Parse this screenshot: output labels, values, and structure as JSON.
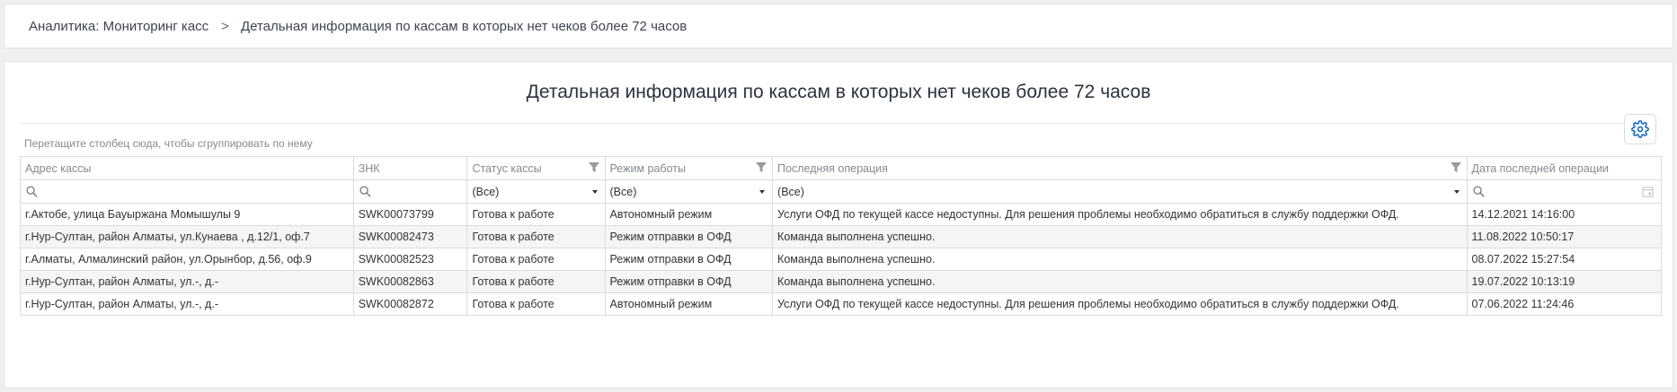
{
  "breadcrumb": {
    "parent": "Аналитика: Мониторинг касс",
    "separator": ">",
    "current": "Детальная информация по кассам в которых нет чеков более 72 часов"
  },
  "panel": {
    "title": "Детальная информация по кассам в которых нет чеков более 72 часов",
    "group_hint": "Перетащите столбец сюда, чтобы сгруппировать по нему",
    "settings_icon": "gear-icon"
  },
  "colors": {
    "accent": "#1a6fc1",
    "row_alt": "#f5f5f5",
    "border": "#dcdcdc"
  },
  "table": {
    "columns": [
      {
        "label": "Адрес кассы"
      },
      {
        "label": "ЗНК"
      },
      {
        "label": "Статус кассы",
        "filter_icon": "funnel-icon"
      },
      {
        "label": "Режим работы",
        "filter_icon": "funnel-icon"
      },
      {
        "label": "Последняя операция",
        "filter_icon": "funnel-icon"
      },
      {
        "label": "Дата последней операции"
      }
    ],
    "filters": {
      "status": "(Все)",
      "mode": "(Все)",
      "last_op": "(Все)"
    },
    "rows": [
      {
        "address": "г.Актобе, улица Бауыржана Момышулы 9",
        "znk": "SWK00073799",
        "status": "Готова к работе",
        "mode": "Автономный режим",
        "last_op": "Услуги ОФД по текущей кассе недоступны. Для решения проблемы необходимо обратиться в службу поддержки ОФД.",
        "date": "14.12.2021 14:16:00"
      },
      {
        "address": "г.Нур-Султан, район Алматы, ул.Кунаева , д.12/1, оф.7",
        "znk": "SWK00082473",
        "status": "Готова к работе",
        "mode": "Режим отправки в ОФД",
        "last_op": "Команда выполнена успешно.",
        "date": "11.08.2022 10:50:17"
      },
      {
        "address": "г.Алматы, Алмалинский район, ул.Орынбор, д.56, оф.9",
        "znk": "SWK00082523",
        "status": "Готова к работе",
        "mode": "Режим отправки в ОФД",
        "last_op": "Команда выполнена успешно.",
        "date": "08.07.2022 15:27:54"
      },
      {
        "address": "г.Нур-Султан, район Алматы, ул.-, д.-",
        "znk": "SWK00082863",
        "status": "Готова к работе",
        "mode": "Режим отправки в ОФД",
        "last_op": "Команда выполнена успешно.",
        "date": "19.07.2022 10:13:19"
      },
      {
        "address": "г.Нур-Султан, район Алматы, ул.-, д.-",
        "znk": "SWK00082872",
        "status": "Готова к работе",
        "mode": "Автономный режим",
        "last_op": "Услуги ОФД по текущей кассе недоступны. Для решения проблемы необходимо обратиться в службу поддержки ОФД.",
        "date": "07.06.2022 11:24:46"
      }
    ]
  }
}
